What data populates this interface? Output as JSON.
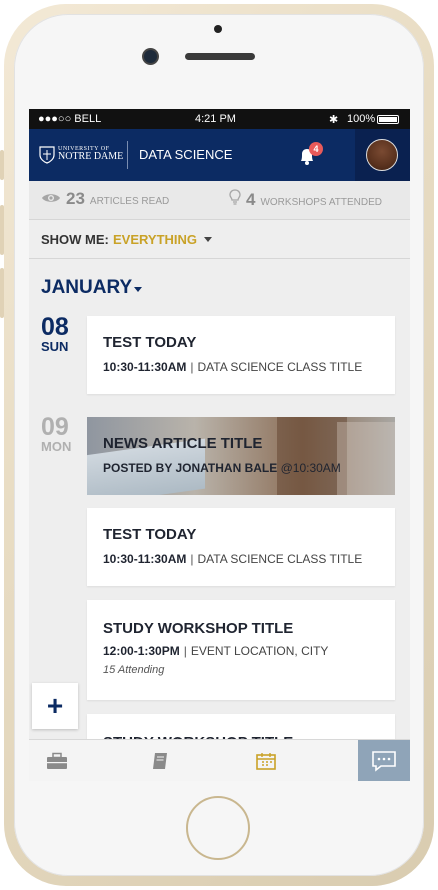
{
  "statusbar": {
    "carrier": "●●●○○ BELL",
    "time": "4:21 PM",
    "battery": "100%"
  },
  "header": {
    "brand_top": "UNIVERSITY OF",
    "brand_bottom": "NOTRE DAME",
    "section": "DATA SCIENCE",
    "notification_count": "4"
  },
  "stats": {
    "articles_count": "23",
    "articles_label": "ARTICLES READ",
    "workshops_count": "4",
    "workshops_label": "WORKSHOPS ATTENDED"
  },
  "filter": {
    "label": "SHOW ME:",
    "value": "EVERYTHING"
  },
  "month": "JANUARY",
  "dates": [
    {
      "num": "08",
      "day": "SUN"
    },
    {
      "num": "09",
      "day": "MON"
    }
  ],
  "events": [
    {
      "title": "TEST TODAY",
      "time": "10:30-11:30AM",
      "detail": "DATA SCIENCE CLASS TITLE"
    },
    {
      "title": "NEWS ARTICLE TITLE",
      "byline": "POSTED BY JONATHAN BALE",
      "posted_at": "@10:30AM"
    },
    {
      "title": "TEST TODAY",
      "time": "10:30-11:30AM",
      "detail": "DATA SCIENCE CLASS TITLE"
    },
    {
      "title": "STUDY WORKSHOP TITLE",
      "time": "12:00-1:30PM",
      "detail": "EVENT LOCATION, CITY",
      "note": "15 Attending"
    },
    {
      "title": "STUDY WORKSHOP TITLE"
    }
  ],
  "fab_label": "+",
  "colors": {
    "navy": "#0c2b63",
    "gold": "#c9a227",
    "badge": "#e85a5a",
    "chat_tab": "#8fa4b8"
  },
  "tabs": [
    "briefcase-icon",
    "book-icon",
    "calendar-icon",
    "chat-icon"
  ]
}
